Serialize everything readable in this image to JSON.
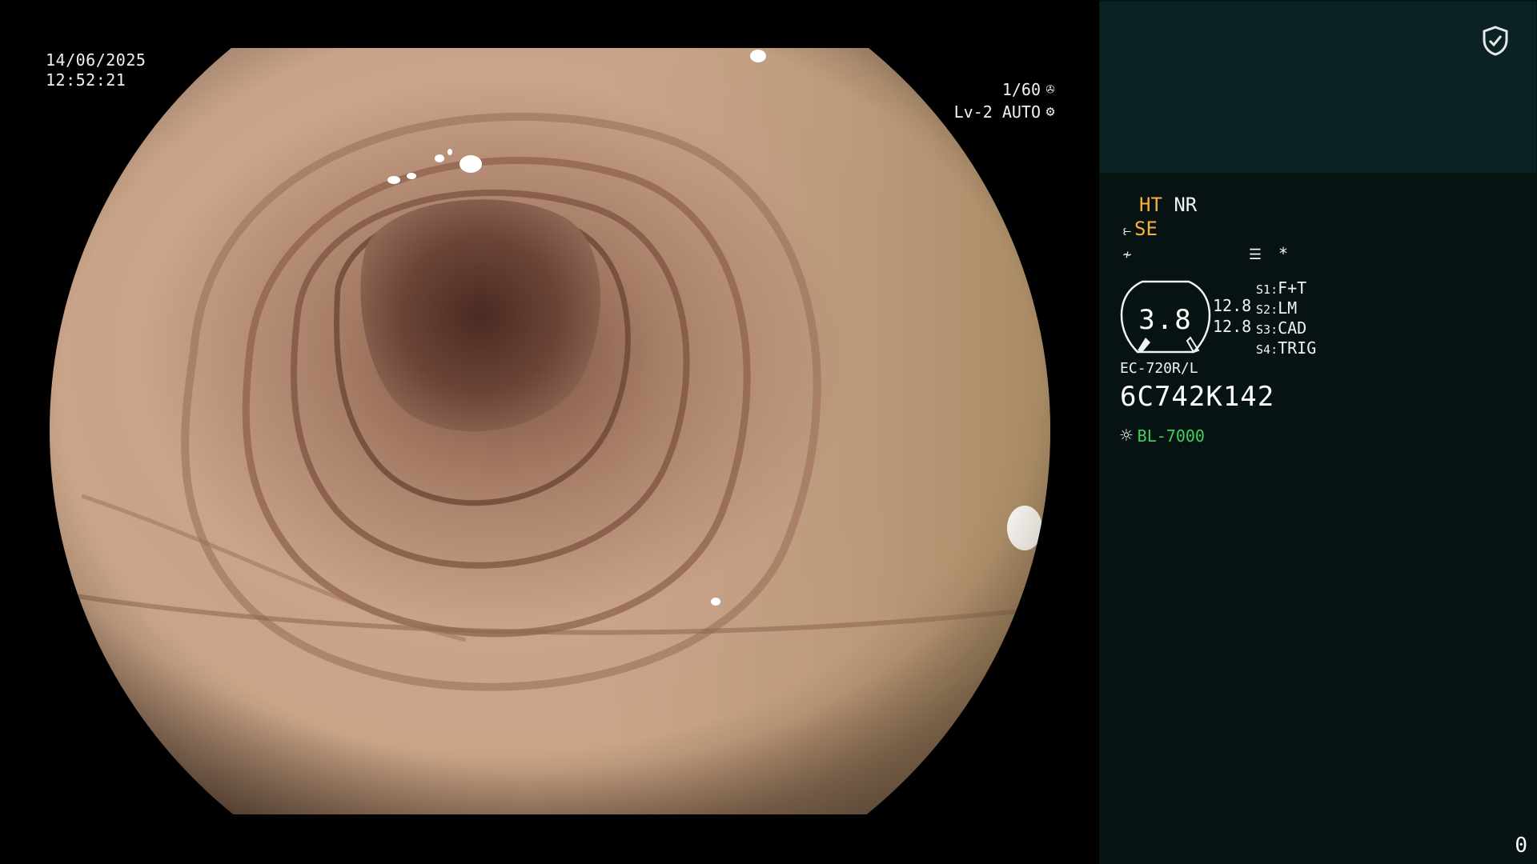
{
  "osd": {
    "date": "14/06/2025",
    "time": "12:52:21",
    "shutter": "1/60",
    "shutter_icon": "aperture-icon",
    "iris": "Lv-2 AUTO",
    "iris_icon": "iris-icon"
  },
  "panel": {
    "top_icon": "shield-check-icon",
    "ht_label": "HT",
    "nr_label": "NR",
    "se_label": "SE",
    "asterisk": "*",
    "gauge_value": "3.8",
    "val_upper": "12.8",
    "val_lower": "12.8",
    "switches": [
      {
        "key": "S1",
        "value": "F+T"
      },
      {
        "key": "S2",
        "value": "LM"
      },
      {
        "key": "S3",
        "value": "CAD"
      },
      {
        "key": "S4",
        "value": "TRIG"
      }
    ],
    "scope_model": "EC-720R/L",
    "serial_number": "6C742K142",
    "light_source": "BL-7000",
    "counter": "0"
  },
  "colors": {
    "panel_bg": "#071212",
    "panel_top_bg": "#0b2224",
    "orange": "#f6b13a",
    "green": "#3ed15b",
    "mucosa": "#c29a80",
    "lumen": "#5a3a2c"
  }
}
